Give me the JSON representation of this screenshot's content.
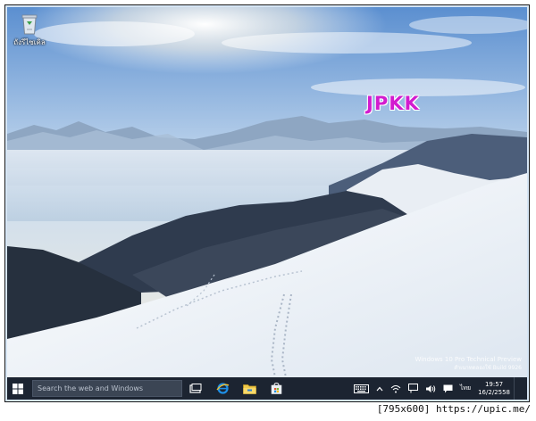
{
  "desktop": {
    "recycle_bin_label": "ถังรีไซเคิล",
    "brand_text": "JPKK",
    "watermark_line1": "Windows 10 Pro Technical Preview",
    "watermark_line2": "สำเนาทดลองใช้ Build 9926"
  },
  "taskbar": {
    "search_placeholder": "Search the web and Windows",
    "pinned": [
      "task-view-icon",
      "internet-explorer-icon",
      "file-explorer-icon",
      "store-icon"
    ],
    "tray_icons": [
      "keyboard-icon",
      "chevron-up-icon",
      "network-icon",
      "action-icon",
      "volume-icon",
      "message-icon"
    ],
    "language": "ไทย",
    "time": "19:57",
    "date": "16/2/2558"
  },
  "footer": {
    "caption": "[795x600] https://upic.me/"
  },
  "colors": {
    "taskbar": "#1c2431",
    "brand": "#d21ccf",
    "search_bg": "#3b4554"
  }
}
